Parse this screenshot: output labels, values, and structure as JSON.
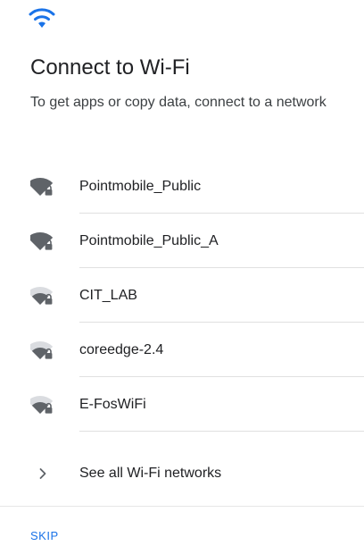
{
  "header": {
    "icon": "wifi-icon",
    "title": "Connect to Wi-Fi",
    "subtitle": "To get apps or copy data, connect to a network"
  },
  "colors": {
    "accent": "#1a73e8",
    "signal_strong": "#5f6368",
    "signal_weak": "#dadce0"
  },
  "networks": [
    {
      "ssid": "Pointmobile_Public",
      "signal_bars": 4,
      "secured": true
    },
    {
      "ssid": "Pointmobile_Public_A",
      "signal_bars": 4,
      "secured": true
    },
    {
      "ssid": "CIT_LAB",
      "signal_bars": 3,
      "secured": true
    },
    {
      "ssid": "coreedge-2.4",
      "signal_bars": 3,
      "secured": true
    },
    {
      "ssid": "E-FosWiFi",
      "signal_bars": 3,
      "secured": true
    }
  ],
  "see_all": {
    "icon": "chevron-right-icon",
    "label": "See all Wi-Fi networks"
  },
  "footer": {
    "skip_label": "SKIP"
  }
}
